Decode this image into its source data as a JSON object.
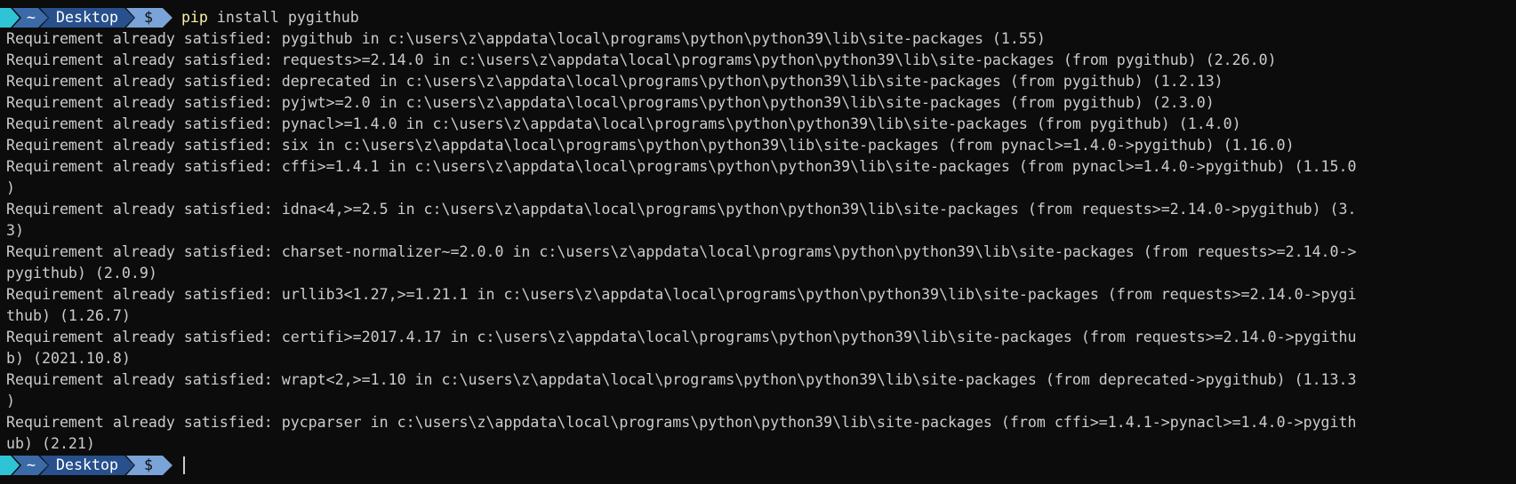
{
  "prompt": {
    "home": "~",
    "directory": "Desktop",
    "symbol": "$"
  },
  "command": {
    "name": "pip",
    "args": "install pygithub"
  },
  "output_lines": [
    "Requirement already satisfied: pygithub in c:\\users\\z\\appdata\\local\\programs\\python\\python39\\lib\\site-packages (1.55)",
    "Requirement already satisfied: requests>=2.14.0 in c:\\users\\z\\appdata\\local\\programs\\python\\python39\\lib\\site-packages (from pygithub) (2.26.0)",
    "Requirement already satisfied: deprecated in c:\\users\\z\\appdata\\local\\programs\\python\\python39\\lib\\site-packages (from pygithub) (1.2.13)",
    "Requirement already satisfied: pyjwt>=2.0 in c:\\users\\z\\appdata\\local\\programs\\python\\python39\\lib\\site-packages (from pygithub) (2.3.0)",
    "Requirement already satisfied: pynacl>=1.4.0 in c:\\users\\z\\appdata\\local\\programs\\python\\python39\\lib\\site-packages (from pygithub) (1.4.0)",
    "Requirement already satisfied: six in c:\\users\\z\\appdata\\local\\programs\\python\\python39\\lib\\site-packages (from pynacl>=1.4.0->pygithub) (1.16.0)",
    "Requirement already satisfied: cffi>=1.4.1 in c:\\users\\z\\appdata\\local\\programs\\python\\python39\\lib\\site-packages (from pynacl>=1.4.0->pygithub) (1.15.0",
    ")",
    "Requirement already satisfied: idna<4,>=2.5 in c:\\users\\z\\appdata\\local\\programs\\python\\python39\\lib\\site-packages (from requests>=2.14.0->pygithub) (3.",
    "3)",
    "Requirement already satisfied: charset-normalizer~=2.0.0 in c:\\users\\z\\appdata\\local\\programs\\python\\python39\\lib\\site-packages (from requests>=2.14.0->",
    "pygithub) (2.0.9)",
    "Requirement already satisfied: urllib3<1.27,>=1.21.1 in c:\\users\\z\\appdata\\local\\programs\\python\\python39\\lib\\site-packages (from requests>=2.14.0->pygi",
    "thub) (1.26.7)",
    "Requirement already satisfied: certifi>=2017.4.17 in c:\\users\\z\\appdata\\local\\programs\\python\\python39\\lib\\site-packages (from requests>=2.14.0->pygithu",
    "b) (2021.10.8)",
    "Requirement already satisfied: wrapt<2,>=1.10 in c:\\users\\z\\appdata\\local\\programs\\python\\python39\\lib\\site-packages (from deprecated->pygithub) (1.13.3",
    ")",
    "Requirement already satisfied: pycparser in c:\\users\\z\\appdata\\local\\programs\\python\\python39\\lib\\site-packages (from cffi>=1.4.1->pynacl>=1.4.0->pygith",
    "ub) (2.21)"
  ],
  "colors": {
    "background": "#0c0c0c",
    "text": "#cccccc",
    "command": "#f9f1a5",
    "segment_start": "#2ec4d6",
    "segment_home": "#3b6aa8",
    "segment_dir": "#27508c",
    "segment_symbol": "#7aa3d8"
  }
}
